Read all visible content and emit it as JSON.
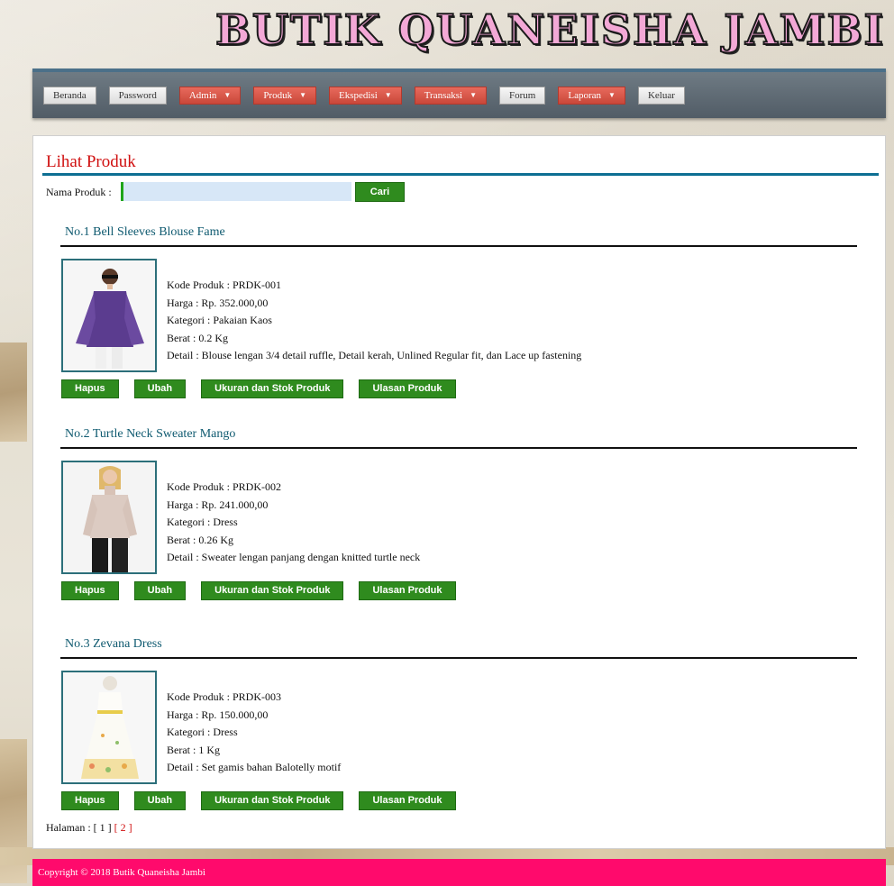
{
  "site": {
    "title": "BUTIK QUANEISHA JAMBI"
  },
  "nav": [
    {
      "label": "Beranda",
      "dropdown": false
    },
    {
      "label": "Password",
      "dropdown": false
    },
    {
      "label": "Admin",
      "dropdown": true
    },
    {
      "label": "Produk",
      "dropdown": true
    },
    {
      "label": "Ekspedisi",
      "dropdown": true
    },
    {
      "label": "Transaksi",
      "dropdown": true
    },
    {
      "label": "Forum",
      "dropdown": false
    },
    {
      "label": "Laporan",
      "dropdown": true
    },
    {
      "label": "Keluar",
      "dropdown": false
    }
  ],
  "main": {
    "heading": "Lihat Produk",
    "search": {
      "label": "Nama Produk :",
      "value": "",
      "button": "Cari"
    }
  },
  "products": [
    {
      "title": "No.1 Bell Sleeves Blouse Fame",
      "kode": "Kode Produk : PRDK-001",
      "harga": "Harga : Rp. 352.000,00",
      "kategori": "Kategori : Pakaian Kaos",
      "berat": "Berat : 0.2 Kg",
      "detail": "Detail : Blouse lengan 3/4 detail ruffle, Detail kerah, Unlined Regular fit, dan Lace up fastening"
    },
    {
      "title": "No.2 Turtle Neck Sweater Mango",
      "kode": "Kode Produk : PRDK-002",
      "harga": "Harga : Rp. 241.000,00",
      "kategori": "Kategori : Dress",
      "berat": "Berat : 0.26 Kg",
      "detail": "Detail : Sweater lengan panjang dengan knitted turtle neck"
    },
    {
      "title": "No.3 Zevana Dress",
      "kode": "Kode Produk : PRDK-003",
      "harga": "Harga : Rp. 150.000,00",
      "kategori": "Kategori : Dress",
      "berat": "Berat : 1 Kg",
      "detail": "Detail : Set gamis bahan Balotelly motif"
    }
  ],
  "actions": {
    "hapus": "Hapus",
    "ubah": "Ubah",
    "ukuran": "Ukuran dan Stok Produk",
    "ulasan": "Ulasan Produk"
  },
  "pager": {
    "label": "Halaman :",
    "pages": [
      "[ 1 ]",
      "[ 2 ]"
    ]
  },
  "footer": {
    "text": "Copyright © 2018 Butik Quaneisha Jambi"
  },
  "colors": {
    "accent_red": "#d01010",
    "button_green": "#2f8b1e",
    "footer_pink": "#ff0a6c",
    "rule_teal": "#0d6f93"
  }
}
